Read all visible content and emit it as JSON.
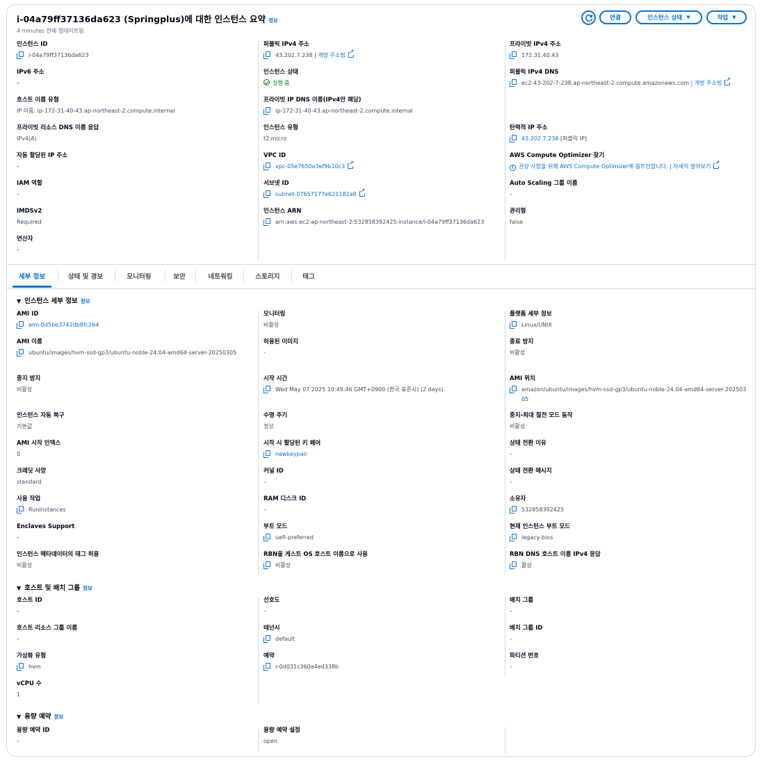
{
  "header": {
    "title": "i-04a79ff37136da623 (Springplus)에 대한 인스턴스 요약",
    "info": "정보",
    "updated": "4 minutes 전에 업데이트됨",
    "btn_connect": "연결",
    "btn_state": "인스턴스 상태",
    "btn_actions": "작업"
  },
  "summary": {
    "c1": [
      {
        "label": "인스턴스 ID",
        "value": "i-04a79ff37136da623"
      },
      {
        "label": "IPv6 주소",
        "value": "–"
      },
      {
        "label": "호스트 이름 유형",
        "value": "IP 이름: ip-172-31-40-43.ap-northeast-2.compute.internal"
      },
      {
        "label": "프라이빗 리소스 DNS 이름 응답",
        "value": "IPv4(A)"
      },
      {
        "label": "자동 할당된 IP 주소",
        "value": "–"
      },
      {
        "label": "IAM 역할",
        "value": "–"
      },
      {
        "label": "IMDSv2",
        "value": "Required"
      },
      {
        "label": "연산자",
        "value": "–"
      }
    ],
    "c2": [
      {
        "label": "퍼블릭 IPv4 주소",
        "value": "43.202.7.238",
        "link": "개방 주소법"
      },
      {
        "label": "인스턴스 상태",
        "value": "실행 중"
      },
      {
        "label": "프라이빗 IP DNS 이름(IPv4만 해당)",
        "value": "ip-172-31-40-43.ap-northeast-2.compute.internal"
      },
      {
        "label": "인스턴스 유형",
        "value": "t2.micro"
      },
      {
        "label": "VPC ID",
        "value": "vpc-05e7650a3ef9b10c3"
      },
      {
        "label": "서브넷 ID",
        "value": "subnet-07657177e621182a8"
      },
      {
        "label": "인스턴스 ARN",
        "value": "arn:aws:ec2:ap-northeast-2:532858392425:instance/i-04a79ff37136da623"
      }
    ],
    "c3": [
      {
        "label": "프라이빗 IPv4 주소",
        "value": "172.31.40.43"
      },
      {
        "label": "퍼블릭 IPv4 DNS",
        "value": "ec2-43-202-7-238.ap-northeast-2.compute.amazonaws.com",
        "sep": " | ",
        "link": "개방 주소법"
      },
      {
        "label": "탄력적 IP 주소",
        "value": "43.202.7.238",
        "suffix": "[퍼블릭 IP]"
      },
      {
        "label": "AWS Compute Optimizer 찾기",
        "value": "권장 사항을 위해 AWS Compute Optimizer에 옵트인합니다.",
        "sep": " | ",
        "link": "자세히 알아보기"
      },
      {
        "label": "Auto Scaling 그룹 이름",
        "value": "–"
      },
      {
        "label": "관리형",
        "value": "false"
      }
    ]
  },
  "tabs": [
    "세부 정보",
    "상태 및 경보",
    "모니터링",
    "보안",
    "네트워킹",
    "스토리지",
    "태그"
  ],
  "details": {
    "title": "인스턴스 세부 정보",
    "info": "정보",
    "c1": [
      {
        "label": "AMI ID",
        "value": "ami-0d5bb3742db8fc264"
      },
      {
        "label": "AMI 이름",
        "value": "ubuntu/images/hvm-ssd-gp3/ubuntu-noble-24.04-amd64-server-20250305"
      },
      {
        "label": "중지 방지",
        "value": "비활성"
      },
      {
        "label": "인스턴스 자동 복구",
        "value": "기본값"
      },
      {
        "label": "AMI 시작 인덱스",
        "value": "0"
      },
      {
        "label": "크레딧 사양",
        "value": "standard"
      },
      {
        "label": "사용 작업",
        "value": "RunInstances"
      },
      {
        "label": "Enclaves Support",
        "value": "–"
      },
      {
        "label": "인스턴스 메타데이터의 태그 허용",
        "value": "비활성"
      }
    ],
    "c2": [
      {
        "label": "모니터링",
        "value": "비활성"
      },
      {
        "label": "허용된 이미지",
        "value": "-"
      },
      {
        "label": "시작 시간",
        "value": "Wed May 07 2025 10:49:46 GMT+0900 (한국 표준시) (2 days)"
      },
      {
        "label": "수명 주기",
        "value": "정상"
      },
      {
        "label": "시작 시 할당된 키 페어",
        "value": "newkeypair"
      },
      {
        "label": "커널 ID",
        "value": "–"
      },
      {
        "label": "RAM 디스크 ID",
        "value": "–"
      },
      {
        "label": "부트 모드",
        "value": "uefi-preferred"
      },
      {
        "label": "RBN을 게스트 OS 호스트 이름으로 사용",
        "value": "비활성"
      }
    ],
    "c3": [
      {
        "label": "플랫폼 세부 정보",
        "value": "Linux/UNIX"
      },
      {
        "label": "종료 방지",
        "value": "비활성"
      },
      {
        "label": "AMI 위치",
        "value": "amazon/ubuntu/images/hvm-ssd-gp3/ubuntu-noble-24.04-amd64-server-20250305"
      },
      {
        "label": "중지-최대 절전 모드 동작",
        "value": "비활성"
      },
      {
        "label": "상태 전환 이유",
        "value": "–"
      },
      {
        "label": "상태 전환 메시지",
        "value": "–"
      },
      {
        "label": "소유자",
        "value": "532858392425"
      },
      {
        "label": "현재 인스턴스 부트 모드",
        "value": "legacy-bios"
      },
      {
        "label": "RBN DNS 호스트 이름 IPv4 응답",
        "value": "활성"
      }
    ]
  },
  "host": {
    "title": "호스트 및 배치 그룹",
    "info": "정보",
    "c1": [
      {
        "label": "호스트 ID",
        "value": "–"
      },
      {
        "label": "호스트 리소스 그룹 이름",
        "value": "–"
      },
      {
        "label": "가상화 유형",
        "value": "hvm"
      },
      {
        "label": "vCPU 수",
        "value": "1"
      }
    ],
    "c2": [
      {
        "label": "선호도",
        "value": "–"
      },
      {
        "label": "테넌시",
        "value": "default"
      },
      {
        "label": "예약",
        "value": "r-0d031c360a4ed338b"
      }
    ],
    "c3": [
      {
        "label": "배치 그룹",
        "value": "–"
      },
      {
        "label": "배치 그룹 ID",
        "value": "–"
      },
      {
        "label": "파티션 번호",
        "value": "–"
      }
    ]
  },
  "capacity": {
    "title": "용량 예약",
    "info": "정보",
    "c1": [
      {
        "label": "용량 예약 ID",
        "value": "–"
      }
    ],
    "c2": [
      {
        "label": "용량 예약 설정",
        "value": "open"
      }
    ]
  }
}
